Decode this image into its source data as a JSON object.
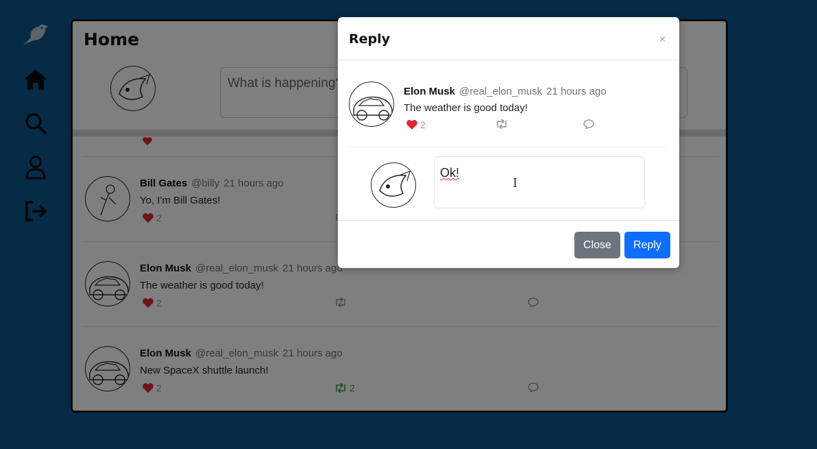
{
  "sidebar": {
    "icons": [
      "bird-logo-icon",
      "home-icon",
      "search-icon",
      "profile-icon",
      "logout-icon"
    ]
  },
  "main": {
    "title": "Home",
    "compose_placeholder": "What is happening?",
    "tweets": [
      {
        "name": "Bill Gates",
        "handle": "@billy",
        "time": "21 hours ago",
        "text": "Yo, I'm Bill Gates!",
        "likes": "2",
        "retweets": ""
      },
      {
        "name": "Elon Musk",
        "handle": "@real_elon_musk",
        "time": "21 hours ago",
        "text": "The weather is good today!",
        "likes": "2",
        "retweets": ""
      },
      {
        "name": "Elon Musk",
        "handle": "@real_elon_musk",
        "time": "21 hours ago",
        "text": "New SpaceX shuttle launch!",
        "likes": "2",
        "retweets": "2"
      }
    ]
  },
  "modal": {
    "title": "Reply",
    "close_x": "×",
    "tweet": {
      "name": "Elon Musk",
      "handle": "@real_elon_musk",
      "time": "21 hours ago",
      "text": "The weather is good today!",
      "likes": "2"
    },
    "reply_value": "Ok!",
    "close_label": "Close",
    "reply_label": "Reply"
  },
  "colors": {
    "background": "#0b568d",
    "like": "#e0262f",
    "retweet_active": "#2e9a3c",
    "primary": "#0d6efd",
    "secondary": "#6c757d"
  }
}
